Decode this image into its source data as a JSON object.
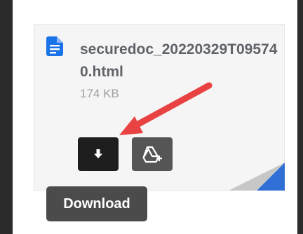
{
  "file": {
    "name": "securedoc_20220329T095740.html",
    "size": "174 KB",
    "icon": "document-icon"
  },
  "actions": {
    "download_icon": "download-arrow-icon",
    "drive_icon": "add-to-drive-icon"
  },
  "tooltip": {
    "text": "Download"
  },
  "colors": {
    "doc_icon": "#1a73e8",
    "annotation_arrow": "#e84242",
    "corner_blue": "#2f6fd6",
    "corner_gray": "#c7c7c7"
  }
}
